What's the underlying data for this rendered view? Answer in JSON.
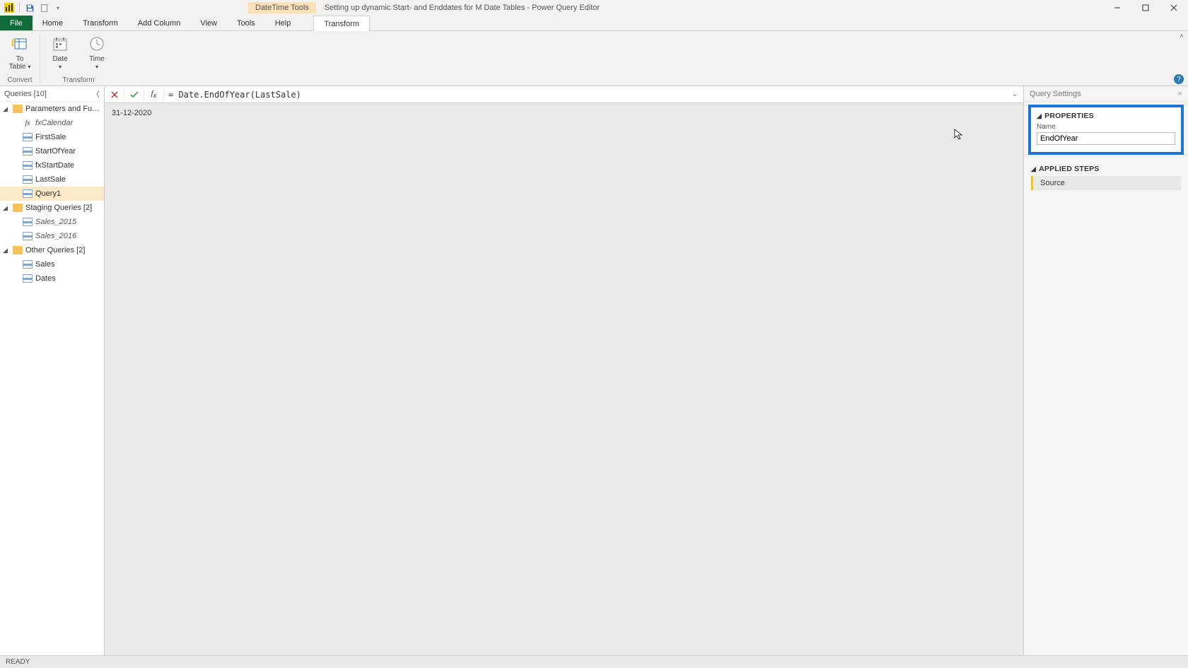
{
  "titlebar": {
    "context_tool": "DateTime Tools",
    "title": "Setting up dynamic Start- and Enddates for M Date Tables - Power Query Editor"
  },
  "menutabs": {
    "file": "File",
    "home": "Home",
    "transform": "Transform",
    "add_column": "Add Column",
    "view": "View",
    "tools": "Tools",
    "help": "Help",
    "transform_context": "Transform"
  },
  "ribbon": {
    "to_table_label": "To\nTable",
    "date_label": "Date",
    "time_label": "Time",
    "group_convert": "Convert",
    "group_transform": "Transform"
  },
  "queries": {
    "header": "Queries [10]",
    "groups": [
      {
        "label": "Parameters and Fu…",
        "items": [
          {
            "label": "fxCalendar",
            "icon": "fx",
            "italic": true
          },
          {
            "label": "FirstSale",
            "icon": "table"
          },
          {
            "label": "StartOfYear",
            "icon": "table"
          },
          {
            "label": "fxStartDate",
            "icon": "table"
          },
          {
            "label": "LastSale",
            "icon": "table"
          },
          {
            "label": "Query1",
            "icon": "table",
            "selected": true
          }
        ]
      },
      {
        "label": "Staging Queries [2]",
        "items": [
          {
            "label": "Sales_2015",
            "icon": "table",
            "italic": true
          },
          {
            "label": "Sales_2016",
            "icon": "table",
            "italic": true
          }
        ]
      },
      {
        "label": "Other Queries [2]",
        "items": [
          {
            "label": "Sales",
            "icon": "table"
          },
          {
            "label": "Dates",
            "icon": "table"
          }
        ]
      }
    ]
  },
  "formula": {
    "text": "= Date.EndOfYear(LastSale)"
  },
  "preview": {
    "value": "31-12-2020"
  },
  "settings": {
    "header": "Query Settings",
    "properties_label": "PROPERTIES",
    "name_label": "Name",
    "name_value": "EndOfYear",
    "applied_steps_label": "APPLIED STEPS",
    "steps": [
      "Source"
    ]
  },
  "status": {
    "text": "READY"
  }
}
